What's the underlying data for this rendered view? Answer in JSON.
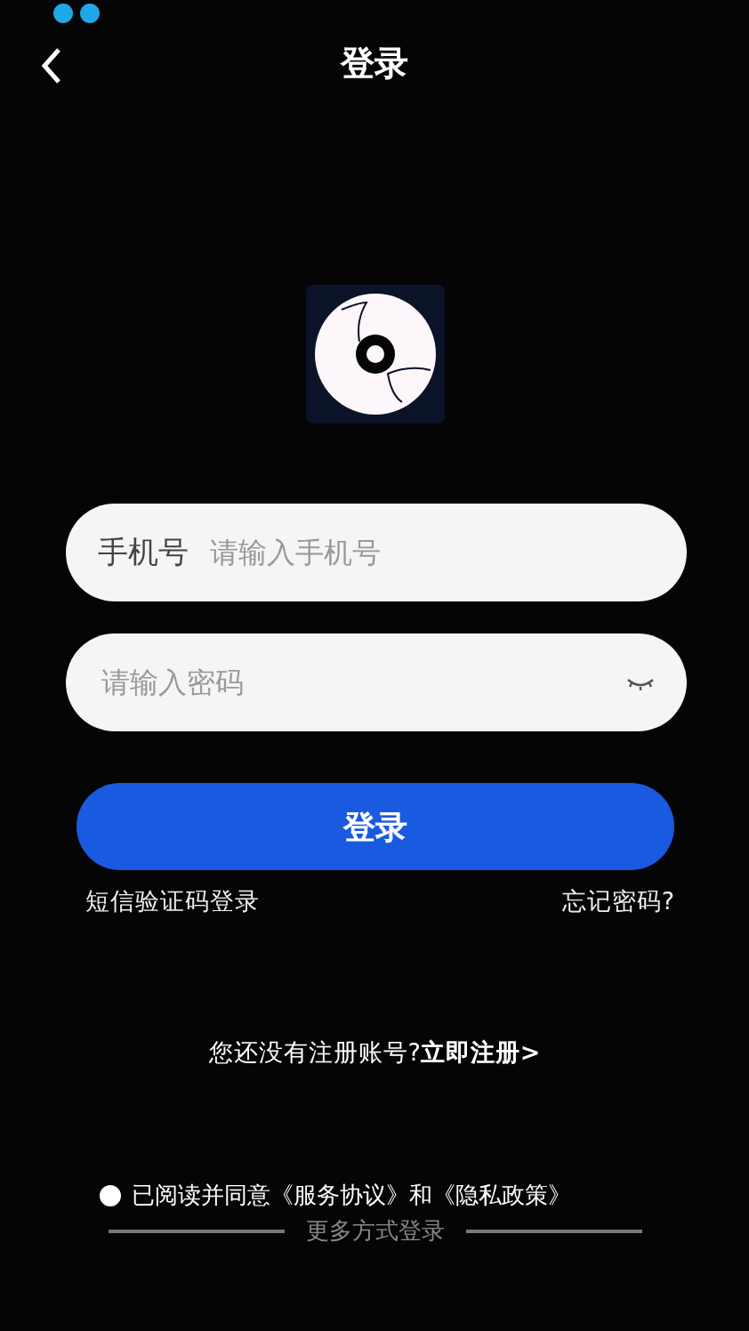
{
  "header": {
    "title": "登录"
  },
  "phone_field": {
    "label": "手机号",
    "placeholder": "请输入手机号"
  },
  "password_field": {
    "placeholder": "请输入密码",
    "password_visible": false
  },
  "login_button": {
    "label": "登录"
  },
  "links": [
    {
      "label": "短信验证码登录"
    },
    {
      "label": "忘记密码?"
    }
  ],
  "register": {
    "text": "您还没有注册账号?",
    "link": "立即注册>"
  },
  "agreement": {
    "checked": false,
    "text": "已阅读并同意《服务协议》和《隐私政策》"
  },
  "more_login": {
    "text": "更多方式登录"
  }
}
